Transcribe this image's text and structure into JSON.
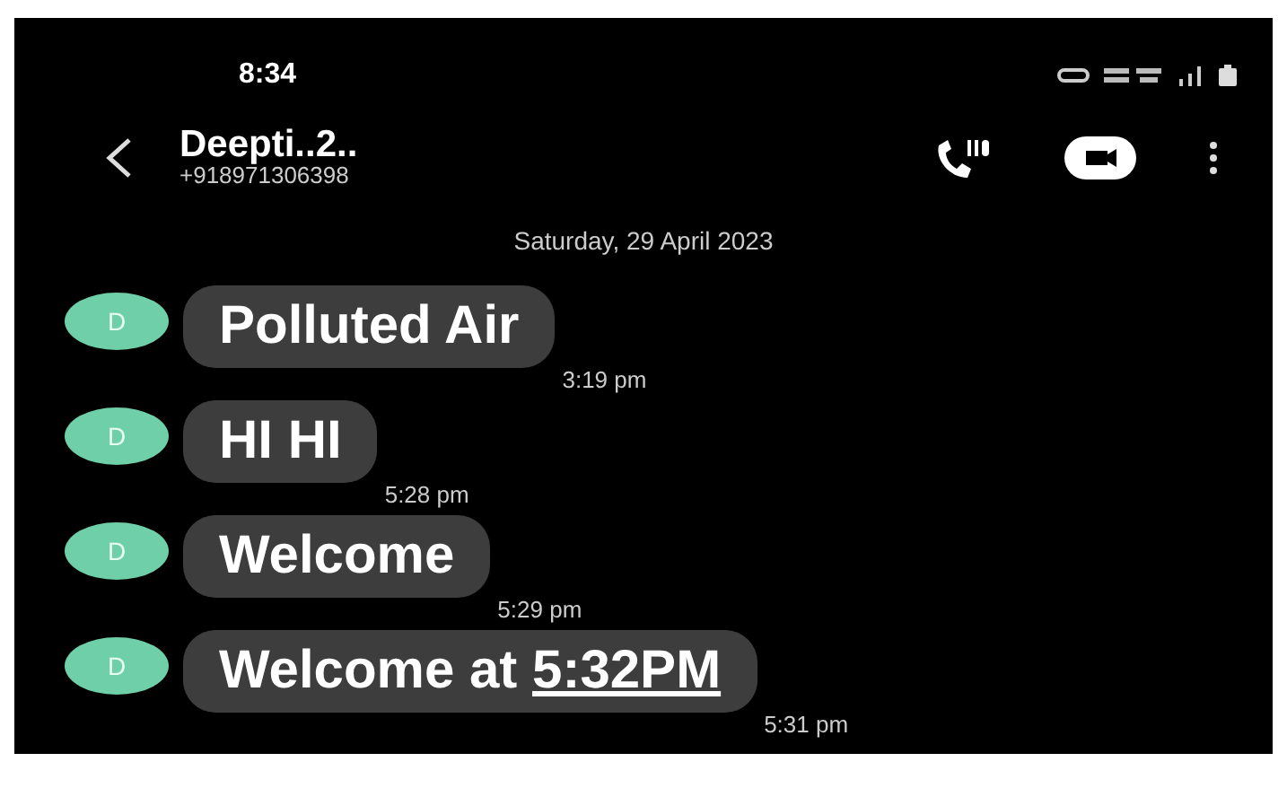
{
  "status_bar": {
    "time": "8:34"
  },
  "header": {
    "contact_name": "Deepti..2..",
    "phone_number": "+918971306398"
  },
  "date_divider": "Saturday, 29 April 2023",
  "messages": [
    {
      "avatar": "D",
      "parts": [
        {
          "kind": "text",
          "text": "Polluted Air"
        }
      ],
      "time": "3:19 pm"
    },
    {
      "avatar": "D",
      "parts": [
        {
          "kind": "text",
          "text": "HI HI"
        }
      ],
      "time": "5:28 pm"
    },
    {
      "avatar": "D",
      "parts": [
        {
          "kind": "text",
          "text": "Welcome"
        }
      ],
      "time": "5:29 pm"
    },
    {
      "avatar": "D",
      "parts": [
        {
          "kind": "text",
          "text": "Welcome at"
        },
        {
          "kind": "link",
          "text": "5:32PM"
        }
      ],
      "time": "5:31 pm"
    }
  ]
}
